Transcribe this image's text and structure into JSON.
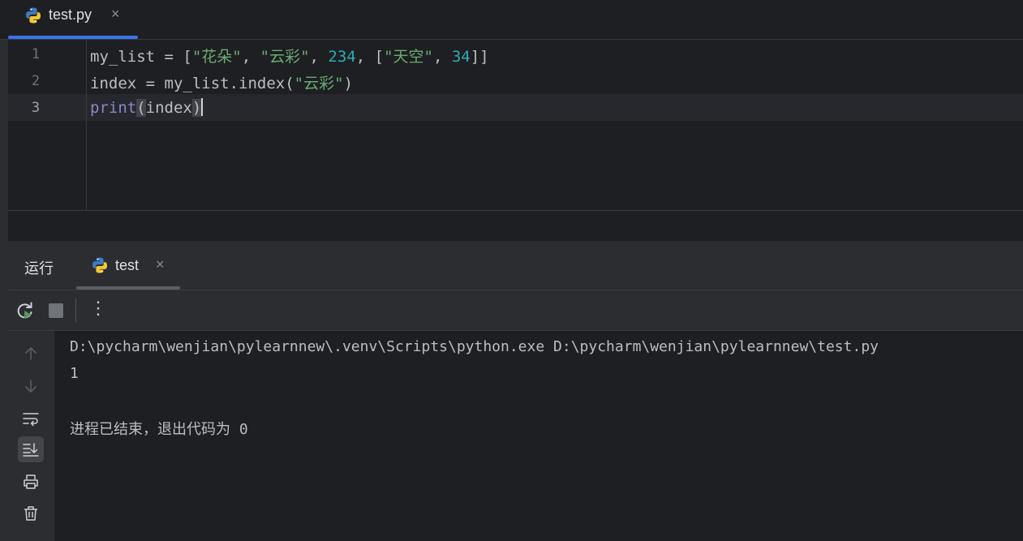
{
  "editor": {
    "tab": {
      "filename": "test.py",
      "close_glyph": "×"
    },
    "lines": [
      {
        "number": "1"
      },
      {
        "number": "2"
      },
      {
        "number": "3"
      }
    ],
    "code": {
      "l1": {
        "var": "my_list = [",
        "s1": "\"花朵\"",
        "sep1": ", ",
        "s2": "\"云彩\"",
        "sep2": ", ",
        "n1": "234",
        "sep3": ", [",
        "s3": "\"天空\"",
        "sep4": ", ",
        "n2": "34",
        "end": "]]"
      },
      "l2": {
        "pre": "index = my_list.index(",
        "s1": "\"云彩\"",
        "end": ")"
      },
      "l3": {
        "fn": "print",
        "open": "(",
        "arg": "index",
        "close": ")"
      }
    }
  },
  "run": {
    "title": "运行",
    "tab": {
      "name": "test",
      "close_glyph": "×"
    },
    "toolbar": {
      "rerun_icon": "rerun-icon",
      "stop_icon": "stop-icon",
      "more_glyph": "⋮"
    },
    "console": {
      "command": "D:\\pycharm\\wenjian\\pylearnnew\\.venv\\Scripts\\python.exe D:\\pycharm\\wenjian\\pylearnnew\\test.py",
      "output": "1",
      "exit_message": "进程已结束，退出代码为 0"
    }
  },
  "colors": {
    "accent": "#3574f0",
    "string": "#6aab73",
    "number": "#2aacb8",
    "builtin": "#8888c6",
    "background": "#1e1f22",
    "panel": "#2b2d30"
  }
}
